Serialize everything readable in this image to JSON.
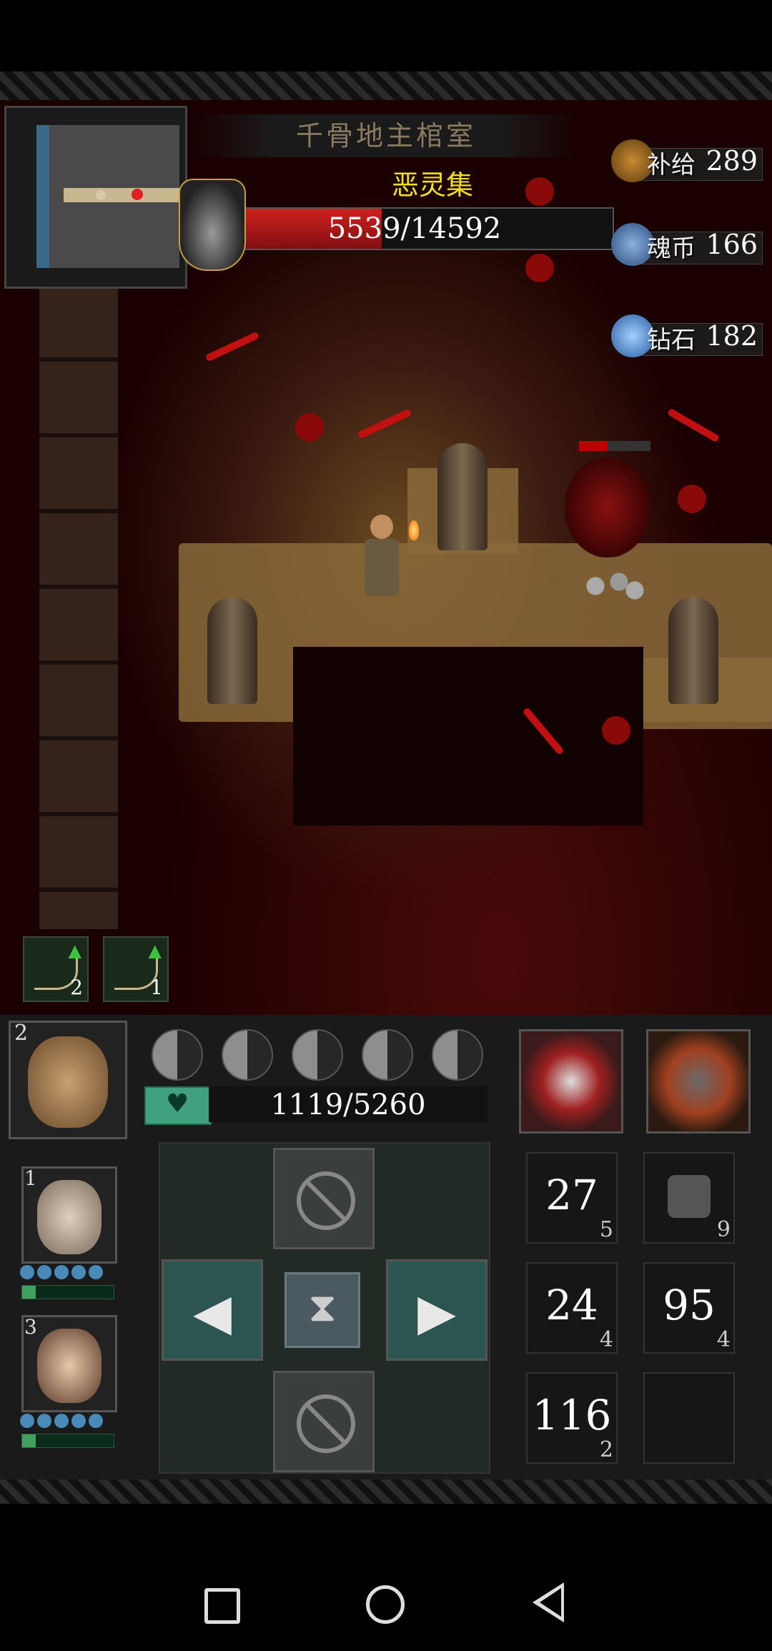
{
  "room": {
    "title": "千骨地主棺室"
  },
  "boss": {
    "name": "恶灵集",
    "hp_current": 5539,
    "hp_max": 14592,
    "hp_text": "5539/14592"
  },
  "resources": [
    {
      "label": "补给",
      "value": "289",
      "icon": "supply-bag-icon"
    },
    {
      "label": "魂币",
      "value": "166",
      "icon": "soul-coin-icon"
    },
    {
      "label": "钻石",
      "value": "182",
      "icon": "diamond-icon"
    }
  ],
  "weapons": [
    {
      "icon": "crossbow-icon",
      "count": "2"
    },
    {
      "icon": "crossbow-icon",
      "count": "1"
    }
  ],
  "player": {
    "slot": "2",
    "hp_text": "1119/5260",
    "hp_current": 1119,
    "hp_max": 5260
  },
  "party": [
    {
      "slot": "1",
      "name_icon": "old-man-portrait"
    },
    {
      "slot": "3",
      "name_icon": "young-man-portrait"
    }
  ],
  "items": [
    {
      "value": "27",
      "count": "5"
    },
    {
      "value": "",
      "count": "9",
      "icon": "bandage-icon"
    },
    {
      "value": "24",
      "count": "4"
    },
    {
      "value": "95",
      "count": "4"
    },
    {
      "value": "116",
      "count": "2"
    },
    {
      "value": "",
      "count": ""
    }
  ],
  "colors": {
    "boss_name": "#f0e020",
    "hp_heart": "#40a080",
    "boss_hp": "#d02020"
  }
}
